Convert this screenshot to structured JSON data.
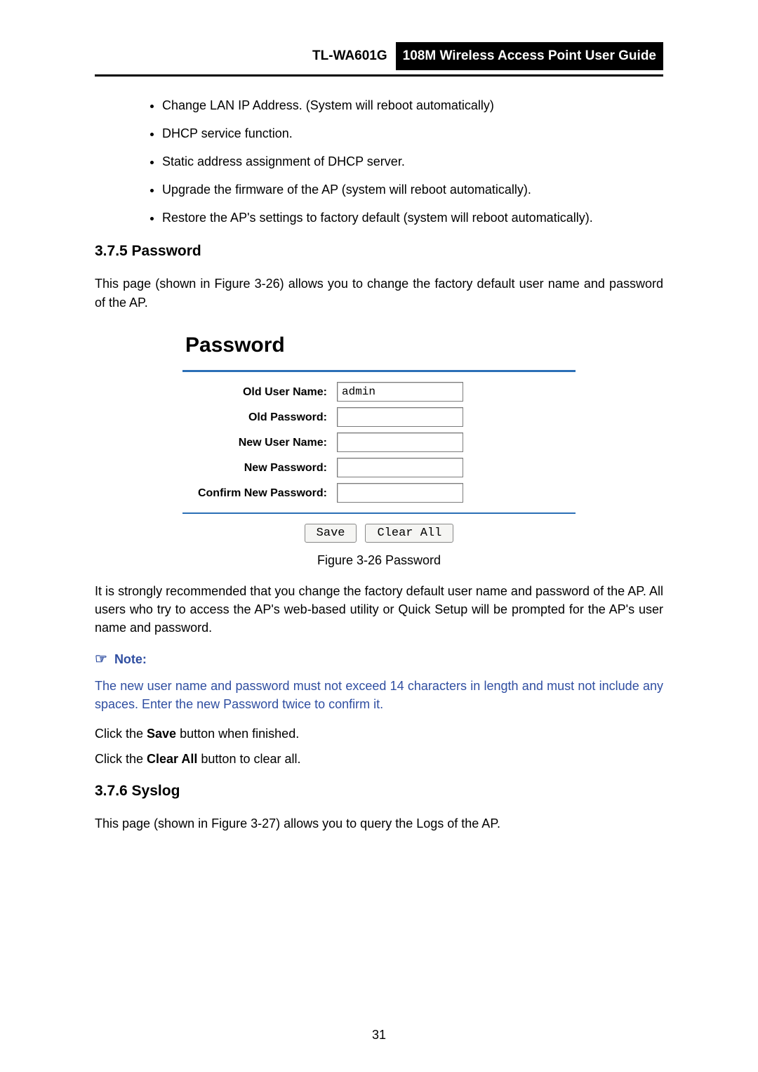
{
  "header": {
    "model": "TL-WA601G",
    "guide": "108M Wireless Access Point User Guide"
  },
  "reboot_list": [
    "Change LAN IP Address. (System will reboot automatically)",
    "DHCP service function.",
    "Static address assignment of DHCP server.",
    "Upgrade the firmware of the AP (system will reboot automatically).",
    "Restore the AP's settings to factory default (system will reboot automatically)."
  ],
  "password_section": {
    "heading": "3.7.5  Password",
    "intro": "This page (shown in Figure 3-26) allows you to change the factory default user name and password of the AP."
  },
  "figure": {
    "title": "Password",
    "fields": {
      "old_user_label": "Old User Name:",
      "old_user_value": "admin",
      "old_pass_label": "Old Password:",
      "new_user_label": "New User Name:",
      "new_pass_label": "New Password:",
      "confirm_label": "Confirm New Password:"
    },
    "buttons": {
      "save": "Save",
      "clear": "Clear All"
    },
    "caption": "Figure 3-26 Password"
  },
  "after_figure": "It is strongly recommended that you change the factory default user name and password of the AP. All users who try to access the AP's web-based utility or Quick Setup will be prompted for the AP's user name and password.",
  "note": {
    "label": "Note:",
    "body": "The new user name and password must not exceed 14 characters in length and must not include any spaces. Enter the new Password twice to confirm it."
  },
  "clicks": {
    "save_pre": "Click the ",
    "save_bold": "Save",
    "save_post": " button when finished.",
    "clear_pre": "Click the ",
    "clear_bold": "Clear All",
    "clear_post": " button to clear all."
  },
  "syslog": {
    "heading": "3.7.6  Syslog",
    "body": "This page (shown in Figure 3-27) allows you to query the Logs of the AP."
  },
  "pagenum": "31"
}
